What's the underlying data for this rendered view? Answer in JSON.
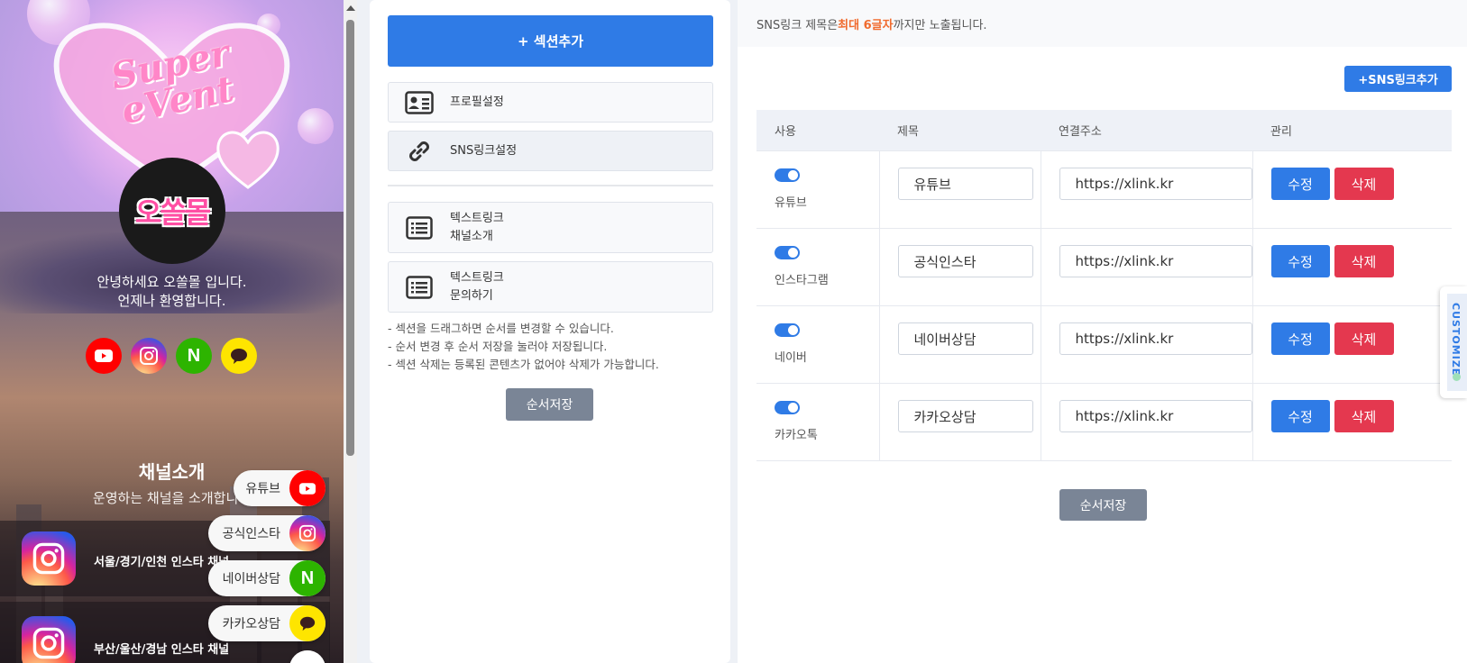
{
  "preview": {
    "banner_text": "Super eVent",
    "logo_text": "오쏠몰",
    "intro_line1": "안녕하세요 오쏠몰 입니다.",
    "intro_line2": "언제나 환영합니다.",
    "channel_title": "채널소개",
    "channel_subtitle": "운영하는 채널을 소개합니다",
    "channels": [
      {
        "label": "서울/경기/인천 인스타 채널",
        "icon": "instagram-icon"
      },
      {
        "label": "부산/울산/경남 인스타 채널",
        "icon": "instagram-icon"
      }
    ],
    "floating_buttons": [
      {
        "label": "유튜브",
        "icon": "youtube-icon",
        "color": "#ff0000"
      },
      {
        "label": "공식인스타",
        "icon": "instagram-icon",
        "color": "#d6249f"
      },
      {
        "label": "네이버상담",
        "icon": "naver-icon",
        "color": "#2db400"
      },
      {
        "label": "카카오상담",
        "icon": "kakao-icon",
        "color": "#fee500"
      }
    ],
    "naver_letter": "N"
  },
  "middle": {
    "add_section_label": "+ 섹션추가",
    "menu": [
      {
        "line1": "프로필설정",
        "line2": "",
        "icon": "profile-card-icon"
      },
      {
        "line1": "SNS링크설정",
        "line2": "",
        "icon": "link-icon"
      },
      {
        "line1": "텍스트링크",
        "line2": "채널소개",
        "icon": "list-icon"
      },
      {
        "line1": "텍스트링크",
        "line2": "문의하기",
        "icon": "list-icon"
      }
    ],
    "notes": [
      "- 섹션을 드래그하면 순서를 변경할 수 있습니다.",
      "- 순서 변경 후 순서 저장을 눌러야 저장됩니다.",
      "- 섹션 삭제는 등록된 콘텐츠가 없어야 삭제가 가능합니다."
    ],
    "save_order_label": "순서저장"
  },
  "right": {
    "notice_prefix": "SNS링크 제목은 ",
    "notice_highlight": "최대 6글자",
    "notice_suffix": "까지만 노출됩니다.",
    "add_sns_label": "+SNS링크추가",
    "columns": [
      "사용",
      "제목",
      "연결주소",
      "관리"
    ],
    "rows": [
      {
        "use_label": "유튜브",
        "title": "유튜브",
        "url": "https://xlink.kr",
        "enabled": true
      },
      {
        "use_label": "인스타그램",
        "title": "공식인스타",
        "url": "https://xlink.kr",
        "enabled": true
      },
      {
        "use_label": "네이버",
        "title": "네이버상담",
        "url": "https://xlink.kr",
        "enabled": true
      },
      {
        "use_label": "카카오톡",
        "title": "카카오상담",
        "url": "https://xlink.kr",
        "enabled": true
      }
    ],
    "edit_label": "수정",
    "delete_label": "삭제",
    "save_order_label": "순서저장"
  },
  "customize_tab_label": "CUSTOMIZE",
  "colors": {
    "primary": "#2f7be6",
    "danger": "#e4384f",
    "highlight": "#f06b2e",
    "secondary": "#7a8596"
  }
}
